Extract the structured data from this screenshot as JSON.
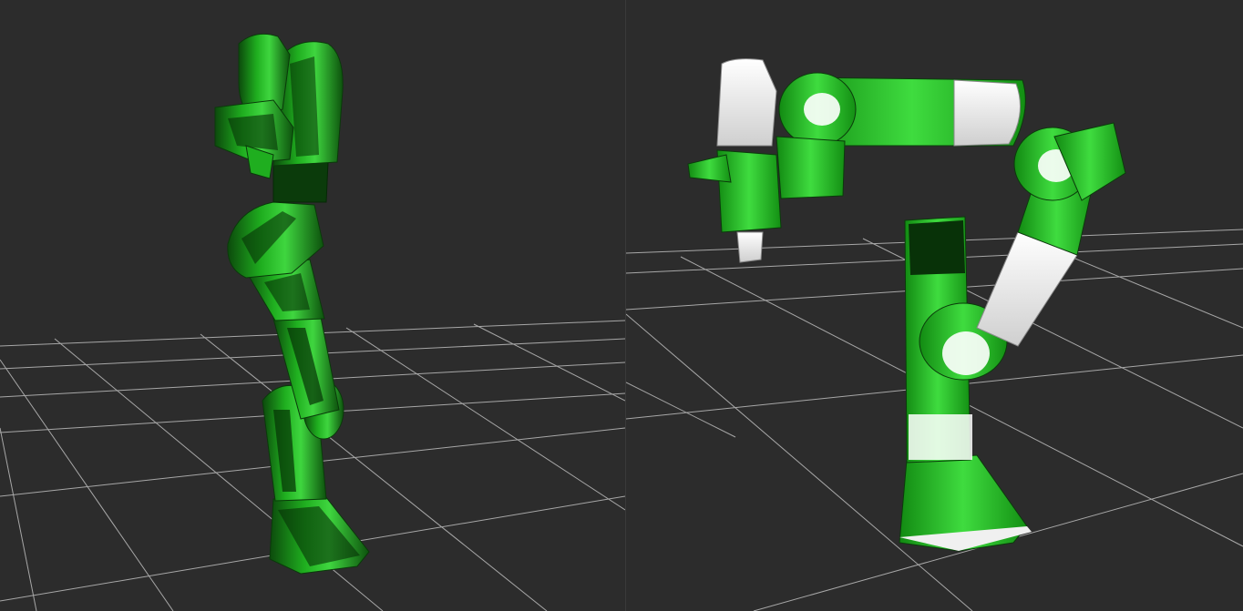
{
  "window": {
    "title": "",
    "layout": "split-view"
  },
  "viewports": [
    {
      "id": "left",
      "view": "side",
      "robot": "robot-arm-mesh",
      "grid": true,
      "colors": {
        "background": "#2c2c2c",
        "grid": "#bdbdbd",
        "link": "#1faa1f",
        "link_dark": "#0a3a0a",
        "highlight": "#55e055"
      }
    },
    {
      "id": "right",
      "view": "perspective",
      "robot": "robot-arm-mesh",
      "grid": true,
      "colors": {
        "background": "#2c2c2c",
        "grid": "#bdbdbd",
        "link": "#22b522",
        "white_link": "#e9e9e9",
        "link_dark": "#0b3b0b",
        "highlight": "#5ae85a"
      }
    }
  ]
}
